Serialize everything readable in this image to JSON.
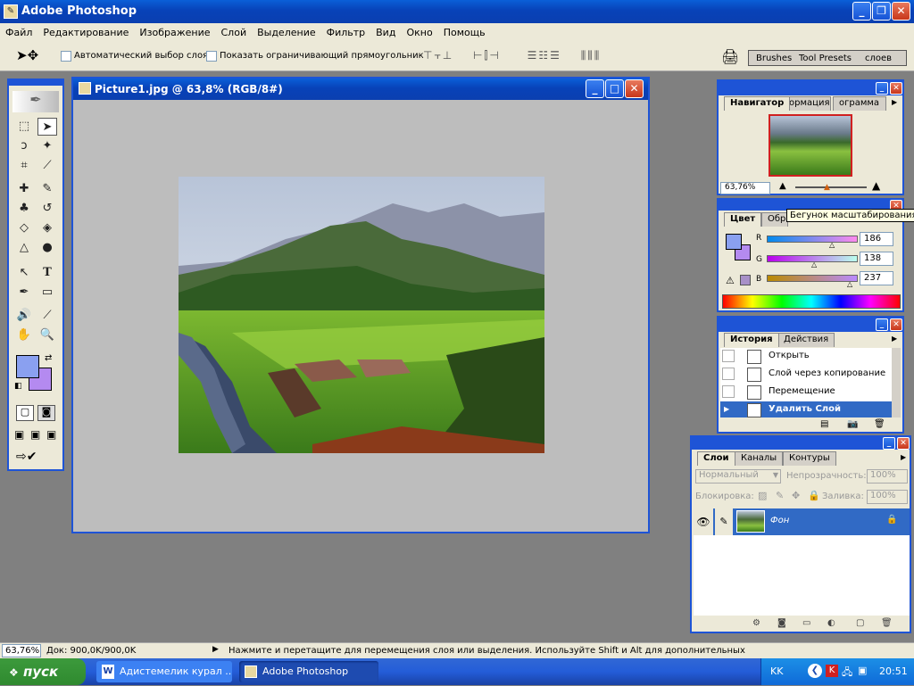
{
  "app": {
    "title": "Adobe Photoshop",
    "title_icon": "ps-feather-icon"
  },
  "menu": [
    "Файл",
    "Редактирование",
    "Изображение",
    "Слой",
    "Выделение",
    "Фильтр",
    "Вид",
    "Окно",
    "Помощь"
  ],
  "options": {
    "auto_select": "Автоматический выбор слоя",
    "show_bounds": "Показать ограничивающий прямоугольник",
    "palette_tabs": [
      "Brushes",
      "Tool Presets",
      "слоев"
    ]
  },
  "document": {
    "title": "Picture1.jpg @ 63,8% (RGB/8#)"
  },
  "navigator": {
    "tabs": [
      "Навигатор",
      "ормация",
      "ограмма"
    ],
    "zoom": "63,76%"
  },
  "color": {
    "tabs": [
      "Цвет",
      "Обр"
    ],
    "tooltip": "Бегунок масштабирования",
    "r_label": "R",
    "g_label": "G",
    "b_label": "B",
    "r": "186",
    "g": "138",
    "b": "237",
    "fg": "#8aa0f0",
    "bg": "#b48af0"
  },
  "history": {
    "tabs": [
      "История",
      "Действия"
    ],
    "items": [
      "Открыть",
      "Слой через копирование",
      "Перемещение",
      "Удалить Слой"
    ]
  },
  "layers": {
    "tabs": [
      "Слои",
      "Каналы",
      "Контуры"
    ],
    "blend_mode": "Нормальный",
    "opacity_label": "Непрозрачность:",
    "opacity": "100%",
    "lock_label": "Блокировка:",
    "fill_label": "Заливка:",
    "fill": "100%",
    "layer_name": "Фон"
  },
  "status": {
    "zoom": "63,76%",
    "doc": "Док: 900,0K/900,0K",
    "hint": "Нажмите и перетащите для перемещения слоя или выделения. Используйте Shift и Alt для дополнительных"
  },
  "taskbar": {
    "start": "пуск",
    "items": [
      "Адистемелик курал ...",
      "Adobe Photoshop"
    ],
    "lang": "KK",
    "time": "20:51"
  }
}
